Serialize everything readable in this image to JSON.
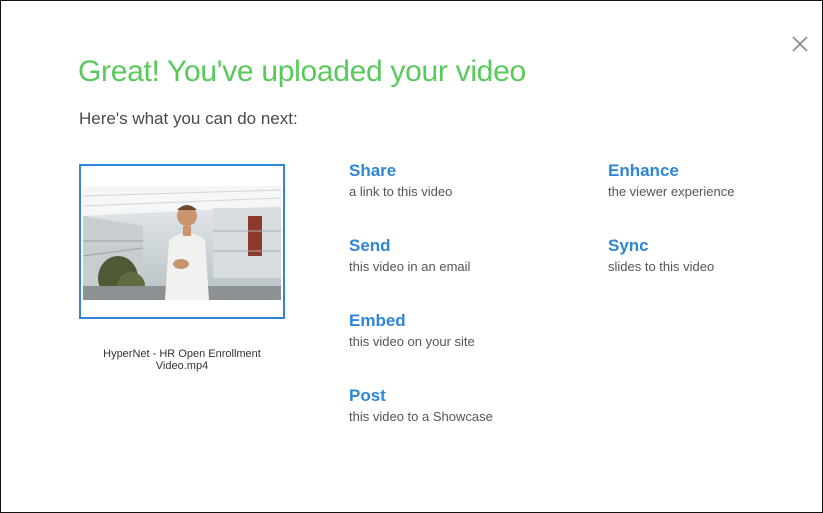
{
  "dialog": {
    "title": "Great! You've uploaded your video",
    "subtitle": "Here's what you can do next:",
    "close_icon": "close-icon"
  },
  "video": {
    "filename": "HyperNet - HR Open Enrollment Video.mp4",
    "thumbnail_icon": "video-thumbnail"
  },
  "actions": [
    {
      "label": "Share",
      "desc": "a link to this video"
    },
    {
      "label": "Send",
      "desc": "this video in an email"
    },
    {
      "label": "Embed",
      "desc": "this video on your site"
    },
    {
      "label": "Post",
      "desc": "this video to a Showcase"
    },
    {
      "label": "Enhance",
      "desc": "the viewer experience"
    },
    {
      "label": "Sync",
      "desc": "slides to this video"
    }
  ],
  "colors": {
    "title_green": "#58c95a",
    "link_blue": "#2f86d6",
    "text_gray": "#555555"
  }
}
